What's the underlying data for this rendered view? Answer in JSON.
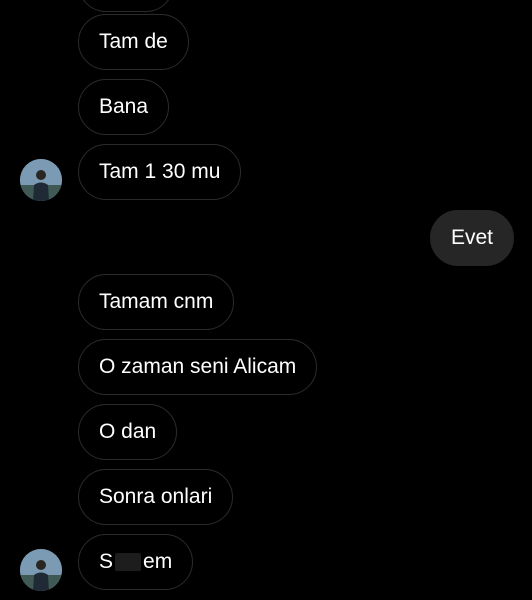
{
  "conversation": {
    "messages": [
      {
        "text": "Tam de",
        "direction": "incoming"
      },
      {
        "text": "Bana",
        "direction": "incoming"
      },
      {
        "text": "Tam 1 30 mu",
        "direction": "incoming"
      },
      {
        "text": "Evet",
        "direction": "outgoing"
      },
      {
        "text": "Tamam cnm",
        "direction": "incoming"
      },
      {
        "text": "O zaman seni Alicam",
        "direction": "incoming"
      },
      {
        "text": "O dan",
        "direction": "incoming"
      },
      {
        "text": "Sonra onlari",
        "direction": "incoming"
      },
      {
        "text_start": "S",
        "text_end": "em",
        "direction": "incoming",
        "partially_redacted": true
      }
    ]
  },
  "colors": {
    "background": "#000000",
    "incoming_border": "#2b2b2b",
    "outgoing_bubble": "#262626",
    "text": "#ffffff"
  },
  "icons": {
    "contact_avatar": "person-photo-avatar"
  }
}
